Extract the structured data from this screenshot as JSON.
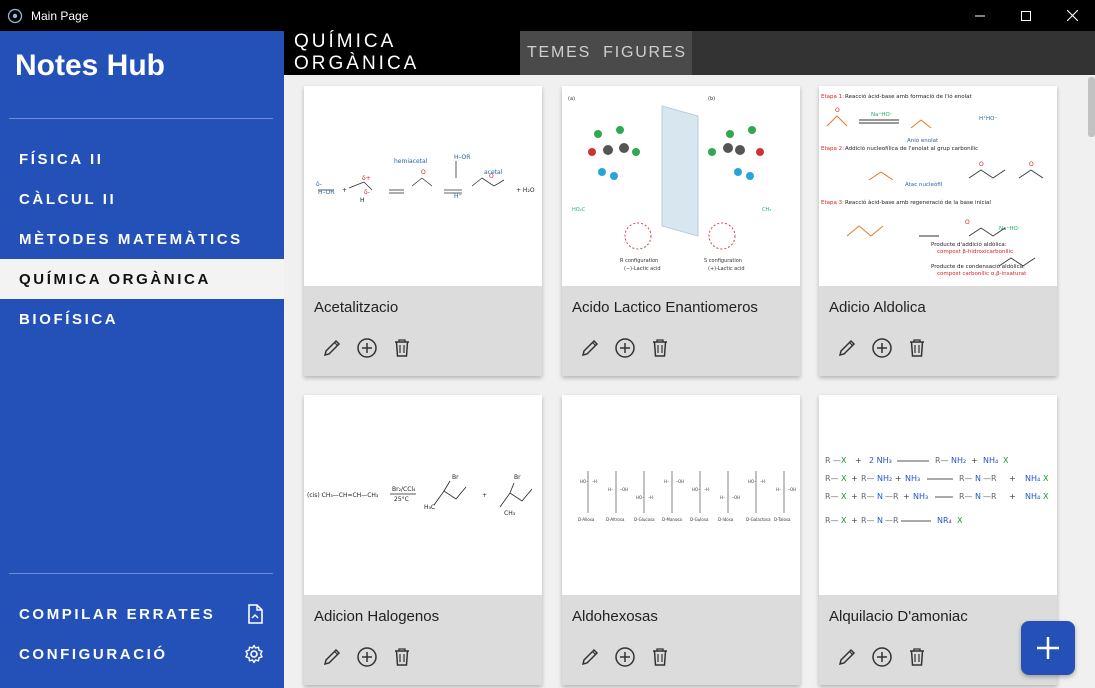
{
  "window": {
    "title": "Main Page"
  },
  "sidebar": {
    "brand": "Notes Hub",
    "items": [
      {
        "label": "FÍSICA II"
      },
      {
        "label": "CÀLCUL II"
      },
      {
        "label": "MÈTODES MATEMÀTICS"
      },
      {
        "label": "QUÍMICA ORGÀNICA"
      },
      {
        "label": "BIOFÍSICA"
      }
    ],
    "bottom": {
      "compile_label": "COMPILAR ERRATES",
      "settings_label": "CONFIGURACIÓ"
    }
  },
  "header": {
    "subject": "QUÍMICA ORGÀNICA",
    "tabs": [
      {
        "label": "TEMES"
      },
      {
        "label": "FIGURES"
      }
    ]
  },
  "cards": [
    {
      "title": "Acetalitzacio"
    },
    {
      "title": "Acido Lactico Enantiomeros"
    },
    {
      "title": "Adicio Aldolica"
    },
    {
      "title": "Adicion Halogenos"
    },
    {
      "title": "Aldohexosas"
    },
    {
      "title": "Alquilacio D'amoniac"
    }
  ],
  "colors": {
    "accent": "#2351b7",
    "titlebar": "#000000",
    "header": "#333333"
  },
  "icons": {
    "edit": "pencil-icon",
    "add": "plus-circle-icon",
    "delete": "trash-icon",
    "compile": "document-icon",
    "settings": "gear-icon",
    "fab": "plus-icon"
  }
}
